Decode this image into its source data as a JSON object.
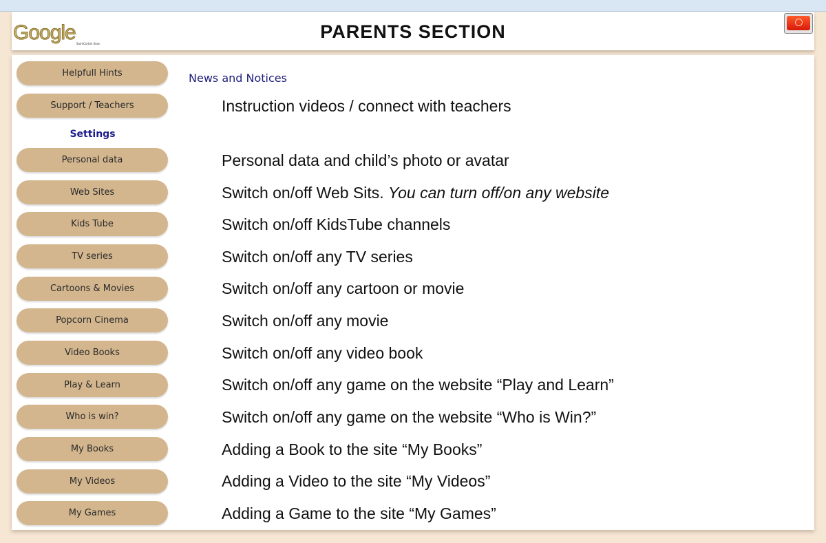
{
  "header": {
    "logo_text": "Google",
    "logo_subtext": "SaintCorbin Sean",
    "title": "PARENTS SECTION",
    "power_button": "power-icon"
  },
  "sidebar": {
    "top_items": [
      {
        "label": "Helpfull Hints"
      },
      {
        "label": "Support / Teachers"
      }
    ],
    "settings_label": "Settings",
    "items": [
      {
        "label": "Personal data"
      },
      {
        "label": "Web Sites"
      },
      {
        "label": "Kids Tube"
      },
      {
        "label": "TV series"
      },
      {
        "label": "Cartoons & Movies"
      },
      {
        "label": "Popcorn Cinema"
      },
      {
        "label": "Video Books"
      },
      {
        "label": "Play & Learn"
      },
      {
        "label": "Who is win?"
      },
      {
        "label": "My Books"
      },
      {
        "label": "My Videos"
      },
      {
        "label": "My Games"
      }
    ]
  },
  "content": {
    "news_label": "News and Notices",
    "support_desc": "Instruction videos / connect with teachers",
    "descriptions": [
      {
        "text": "Personal data and child’s photo or avatar"
      },
      {
        "text": "Switch on/off Web Sits. ",
        "italic": "You can turn off/on any website"
      },
      {
        "text": "Switch on/off KidsTube channels"
      },
      {
        "text": "Switch on/off any TV series"
      },
      {
        "text": "Switch on/off any cartoon or movie"
      },
      {
        "text": "Switch on/off any movie"
      },
      {
        "text": "Switch on/off any video book"
      },
      {
        "text": "Switch on/off any game on the website “Play and Learn”"
      },
      {
        "text": "Switch on/off any game on the website “Who is Win?”"
      },
      {
        "text": "Adding a Book to the site “My Books”"
      },
      {
        "text": "Adding a Video to the site “My Videos”"
      },
      {
        "text": "Adding a Game to the site “My Games”"
      }
    ]
  }
}
